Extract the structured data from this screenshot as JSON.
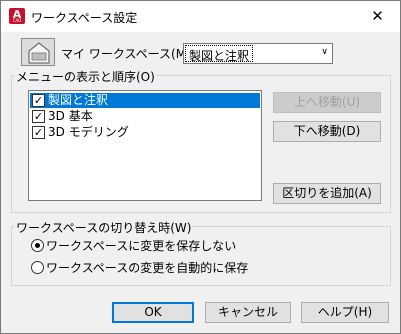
{
  "window": {
    "title": "ワークスペース設定",
    "close_glyph": "✕",
    "app_icon_letter": "A",
    "app_icon_sub": "CAD"
  },
  "workspace": {
    "label": "マイ ワークスペース(M) =",
    "selected": "製図と注釈",
    "arrow_glyph": "∨"
  },
  "menu_group": {
    "label": "メニューの表示と順序(O)",
    "items": [
      {
        "label": "製図と注釈",
        "checked": true,
        "selected": true
      },
      {
        "label": "3D 基本",
        "checked": true,
        "selected": false
      },
      {
        "label": "3D モデリング",
        "checked": true,
        "selected": false
      }
    ],
    "check_glyph": "✓",
    "move_up_label": "上へ移動(U)",
    "move_up_enabled": false,
    "move_down_label": "下へ移動(D)",
    "add_separator_label": "区切りを追加(A)"
  },
  "switch_group": {
    "label": "ワークスペースの切り替え時(W)",
    "options": [
      {
        "label": "ワークスペースに変更を保存しない",
        "selected": true
      },
      {
        "label": "ワークスペースの変更を自動的に保存",
        "selected": false
      }
    ]
  },
  "footer": {
    "ok_label": "OK",
    "cancel_label": "キャンセル",
    "help_label": "ヘルプ(H)"
  },
  "colors": {
    "selection": "#0078d7",
    "window_bg": "#f0f0f0",
    "app_icon": "#c8102e"
  }
}
